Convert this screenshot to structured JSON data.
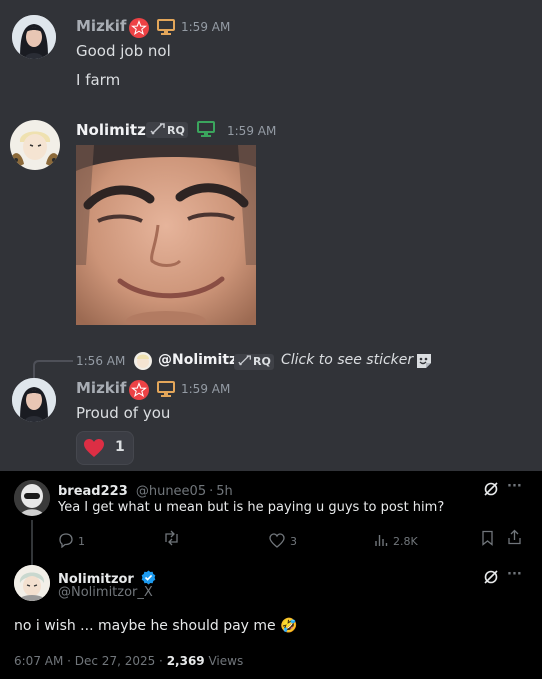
{
  "messages": [
    {
      "author": "Mizkif",
      "time": "1:59 AM",
      "lines": [
        "Good job nol",
        "I farm"
      ]
    },
    {
      "author": "Nolimitz",
      "tag": "RQ",
      "time": "1:59 AM"
    }
  ],
  "reply": {
    "time": "1:56 AM",
    "mention": "@Nolimitz",
    "tag": "RQ",
    "text": "Click to see sticker"
  },
  "third": {
    "author": "Mizkif",
    "time": "1:59 AM",
    "text": "Proud of you",
    "reaction_count": "1"
  },
  "tweet1": {
    "name": "bread223",
    "handle": "@hunee05",
    "age": "5h",
    "dot": "·",
    "text": "Yea I get what u mean but is he paying u guys to post him?",
    "replies": "1",
    "likes": "3",
    "views": "2.8K"
  },
  "tweet2": {
    "name": "Nolimitzor",
    "handle": "@Nolimitzor_X",
    "text": "no i wish ... maybe he should pay me 🤣",
    "datetime": "6:07 AM · Dec 27, 2025 · ",
    "views_count": "2,369",
    "views_label": "Views"
  },
  "icons": {
    "more": "···"
  },
  "colors": {
    "mizkif_name": "#dbdee1",
    "accent_red": "#ed4245",
    "verified": "#1d9bf0"
  }
}
